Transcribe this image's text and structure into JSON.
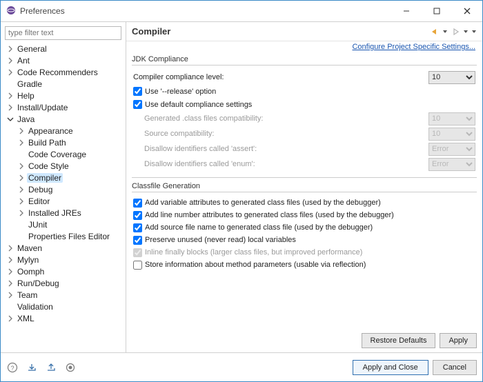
{
  "window": {
    "title": "Preferences"
  },
  "filter": {
    "placeholder": "type filter text"
  },
  "tree": {
    "items": [
      {
        "label": "General",
        "level": 1,
        "expandable": true,
        "expanded": false
      },
      {
        "label": "Ant",
        "level": 1,
        "expandable": true,
        "expanded": false
      },
      {
        "label": "Code Recommenders",
        "level": 1,
        "expandable": true,
        "expanded": false
      },
      {
        "label": "Gradle",
        "level": 1,
        "expandable": false
      },
      {
        "label": "Help",
        "level": 1,
        "expandable": true,
        "expanded": false
      },
      {
        "label": "Install/Update",
        "level": 1,
        "expandable": true,
        "expanded": false
      },
      {
        "label": "Java",
        "level": 1,
        "expandable": true,
        "expanded": true
      },
      {
        "label": "Appearance",
        "level": 2,
        "expandable": true,
        "expanded": false
      },
      {
        "label": "Build Path",
        "level": 2,
        "expandable": true,
        "expanded": false
      },
      {
        "label": "Code Coverage",
        "level": 2,
        "expandable": false
      },
      {
        "label": "Code Style",
        "level": 2,
        "expandable": true,
        "expanded": false
      },
      {
        "label": "Compiler",
        "level": 2,
        "expandable": true,
        "expanded": false,
        "selected": true
      },
      {
        "label": "Debug",
        "level": 2,
        "expandable": true,
        "expanded": false
      },
      {
        "label": "Editor",
        "level": 2,
        "expandable": true,
        "expanded": false
      },
      {
        "label": "Installed JREs",
        "level": 2,
        "expandable": true,
        "expanded": false
      },
      {
        "label": "JUnit",
        "level": 2,
        "expandable": false
      },
      {
        "label": "Properties Files Editor",
        "level": 2,
        "expandable": false
      },
      {
        "label": "Maven",
        "level": 1,
        "expandable": true,
        "expanded": false
      },
      {
        "label": "Mylyn",
        "level": 1,
        "expandable": true,
        "expanded": false
      },
      {
        "label": "Oomph",
        "level": 1,
        "expandable": true,
        "expanded": false
      },
      {
        "label": "Run/Debug",
        "level": 1,
        "expandable": true,
        "expanded": false
      },
      {
        "label": "Team",
        "level": 1,
        "expandable": true,
        "expanded": false
      },
      {
        "label": "Validation",
        "level": 1,
        "expandable": false
      },
      {
        "label": "XML",
        "level": 1,
        "expandable": true,
        "expanded": false
      }
    ]
  },
  "page": {
    "heading": "Compiler",
    "link": "Configure Project Specific Settings...",
    "jdk": {
      "title": "JDK Compliance",
      "compliance_label": "Compiler compliance level:",
      "compliance_value": "10",
      "use_release": {
        "label": "Use '--release' option",
        "checked": true
      },
      "use_default": {
        "label": "Use default compliance settings",
        "checked": true
      },
      "gen_class_label": "Generated .class files compatibility:",
      "gen_class_value": "10",
      "source_compat_label": "Source compatibility:",
      "source_compat_value": "10",
      "disallow_assert_label": "Disallow identifiers called 'assert':",
      "disallow_assert_value": "Error",
      "disallow_enum_label": "Disallow identifiers called 'enum':",
      "disallow_enum_value": "Error"
    },
    "classfile": {
      "title": "Classfile Generation",
      "opts": [
        {
          "label": "Add variable attributes to generated class files (used by the debugger)",
          "checked": true,
          "disabled": false
        },
        {
          "label": "Add line number attributes to generated class files (used by the debugger)",
          "checked": true,
          "disabled": false
        },
        {
          "label": "Add source file name to generated class file (used by the debugger)",
          "checked": true,
          "disabled": false
        },
        {
          "label": "Preserve unused (never read) local variables",
          "checked": true,
          "disabled": false
        },
        {
          "label": "Inline finally blocks (larger class files, but improved performance)",
          "checked": true,
          "disabled": true
        },
        {
          "label": "Store information about method parameters (usable via reflection)",
          "checked": false,
          "disabled": false
        }
      ]
    },
    "restore": "Restore Defaults",
    "apply": "Apply"
  },
  "footer": {
    "apply_close": "Apply and Close",
    "cancel": "Cancel"
  }
}
